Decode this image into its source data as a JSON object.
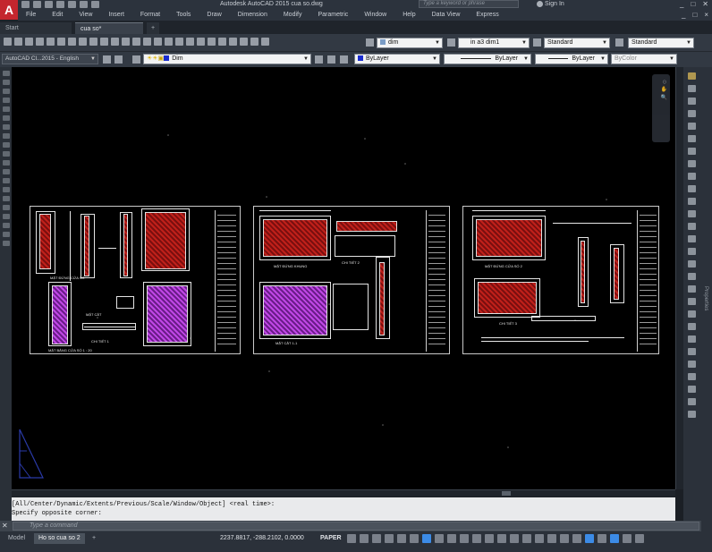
{
  "app": {
    "logo": "A",
    "title": "Autodesk AutoCAD 2015    cua so.dwg",
    "search_placeholder": "Type a keyword or phrase",
    "sign_in": "Sign In",
    "window_controls": [
      "_",
      "□",
      "✕"
    ],
    "menu": [
      "File",
      "Edit",
      "View",
      "Insert",
      "Format",
      "Tools",
      "Draw",
      "Dimension",
      "Modify",
      "Parametric",
      "Window",
      "Help",
      "Data View",
      "Express"
    ],
    "menu_right_controls": [
      "_",
      "□",
      "×"
    ]
  },
  "tabs": {
    "start": "Start",
    "file": "cua so*",
    "add": "+"
  },
  "toolbar1": {
    "dimstyle_combo": "dim",
    "scale_combo": "in a3 dim1",
    "textstyle_combo": "Standard",
    "tablestyle_combo": "Standard"
  },
  "toolbar2": {
    "workspace_combo": "AutoCAD Cl...2015 - English",
    "layer_combo": "Dim",
    "color_combo": "ByLayer",
    "linetype_combo": "ByLayer",
    "lineweight_combo": "ByLayer",
    "plotstyle_combo": "ByColor",
    "colors": {
      "layer_swatch": "#1a2ccf",
      "color_swatch": "#1a2ccf"
    }
  },
  "right_panel": {
    "label": "Properties"
  },
  "drawing": {
    "labels": [
      "MẶT ĐỨNG CỬA SỔ",
      "MẶT CẮT",
      "CHI TIẾT 1",
      "MẶT BẰNG CỬA SỔ 1 : 20",
      "MẶT ĐỨNG KHUNG",
      "CHI TIẾT 2",
      "MẶT CẮT 1-1",
      "MẶT ĐỨNG CỬA SỔ 2",
      "CHI TIẾT 3"
    ]
  },
  "command": {
    "history": [
      "[All/Center/Dynamic/Extents/Previous/Scale/Window/Object] <real time>:",
      "Specify opposite corner:"
    ],
    "placeholder": "Type a command"
  },
  "status": {
    "model_tab": "Model",
    "layout_tab": "Ho so cua so 2",
    "add_tab": "+",
    "coords": "2237.8817, -288.2102, 0.0000",
    "space": "PAPER"
  }
}
